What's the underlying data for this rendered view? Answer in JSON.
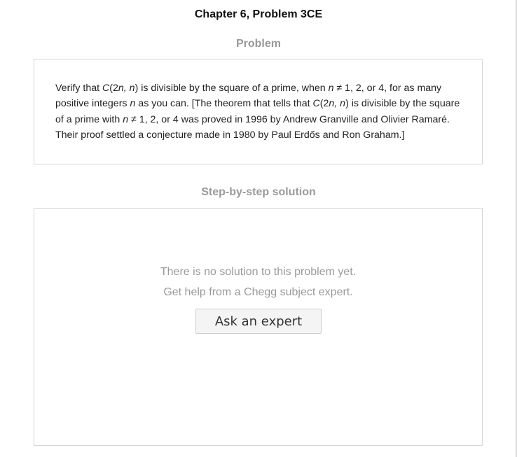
{
  "header": {
    "title": "Chapter 6, Problem 3CE"
  },
  "problem": {
    "label": "Problem",
    "segments": [
      "Verify that ",
      "C",
      "(2",
      "n, n",
      ") is divisible by the square of a prime, when ",
      "n",
      " ≠ 1, 2, or 4, for as many positive integers ",
      "n",
      " as you can. [The theorem that tells that ",
      "C",
      "(2",
      "n, n",
      ") is divisible by the square of a prime with ",
      "n",
      " ≠ 1, 2, or 4 was proved in 1996 by Andrew Granville and Olivier Ramaré. Their proof settled a conjecture made in 1980 by Paul Erdős and Ron Graham.]"
    ]
  },
  "solution": {
    "label": "Step-by-step solution",
    "empty_line_1": "There is no solution to this problem yet.",
    "empty_line_2": "Get help from a Chegg subject expert.",
    "ask_button_label": "Ask an expert"
  }
}
